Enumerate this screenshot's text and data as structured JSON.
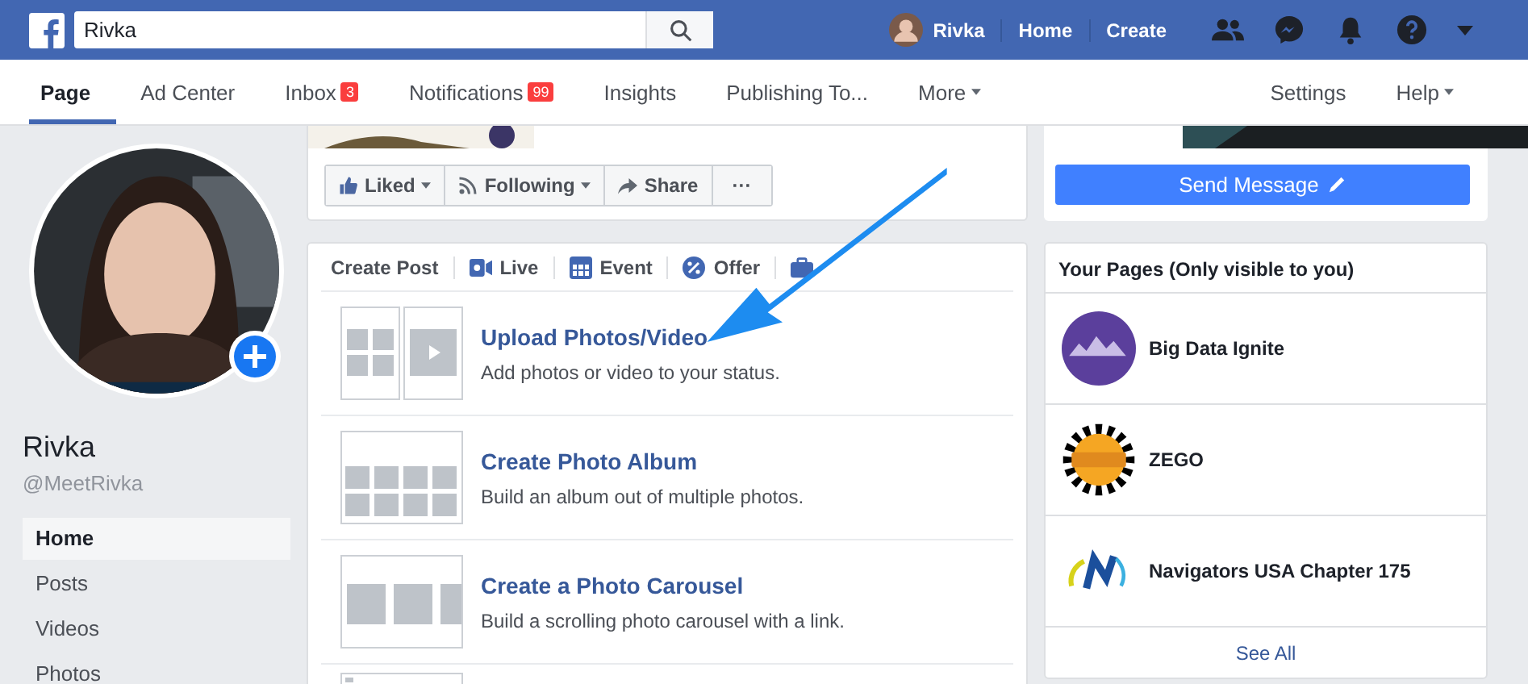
{
  "topbar": {
    "search": {
      "value": "Rivka"
    },
    "user": "Rivka",
    "links": [
      "Home",
      "Create"
    ]
  },
  "page_tabs": [
    {
      "label": "Page",
      "selected": true
    },
    {
      "label": "Ad Center",
      "selected": false
    },
    {
      "label": "Inbox",
      "selected": false,
      "badge": "3"
    },
    {
      "label": "Notifications",
      "selected": false,
      "badge": "99"
    },
    {
      "label": "Insights",
      "selected": false
    },
    {
      "label": "Publishing To...",
      "selected": false
    },
    {
      "label": "More",
      "selected": false,
      "caret": true
    }
  ],
  "right_tabs": [
    {
      "label": "Settings",
      "caret": false
    },
    {
      "label": "Help",
      "caret": true
    }
  ],
  "profile": {
    "name": "Rivka",
    "handle": "@MeetRivka"
  },
  "sidebar": {
    "items": [
      {
        "label": "Home",
        "selected": true
      },
      {
        "label": "Posts",
        "selected": false
      },
      {
        "label": "Videos",
        "selected": false
      },
      {
        "label": "Photos",
        "selected": false
      }
    ]
  },
  "actions": [
    {
      "kind": "like",
      "label": "Liked",
      "caret": true
    },
    {
      "kind": "follow",
      "label": "Following",
      "caret": true
    },
    {
      "kind": "share",
      "label": "Share",
      "caret": false
    },
    {
      "kind": "more",
      "label": "···",
      "caret": false
    }
  ],
  "send_message": "Send Message",
  "composer_tabs": [
    {
      "kind": "text",
      "label": "Create Post"
    },
    {
      "kind": "live",
      "label": "Live"
    },
    {
      "kind": "event",
      "label": "Event"
    },
    {
      "kind": "offer",
      "label": "Offer"
    },
    {
      "kind": "job"
    }
  ],
  "composer_options": [
    {
      "kind": "upload",
      "title": "Upload Photos/Video",
      "description": "Add photos or video to your status."
    },
    {
      "kind": "album",
      "title": "Create Photo Album",
      "description": "Build an album out of multiple photos."
    },
    {
      "kind": "carousel",
      "title": "Create a Photo Carousel",
      "description": "Build a scrolling photo carousel with a link."
    },
    {
      "kind": "more"
    }
  ],
  "your_pages": {
    "title": "Your Pages (Only visible to you)",
    "items": [
      {
        "name": "Big Data Ignite"
      },
      {
        "name": "ZEGO"
      },
      {
        "name": "Navigators USA Chapter 175"
      }
    ],
    "see_all": "See All"
  }
}
